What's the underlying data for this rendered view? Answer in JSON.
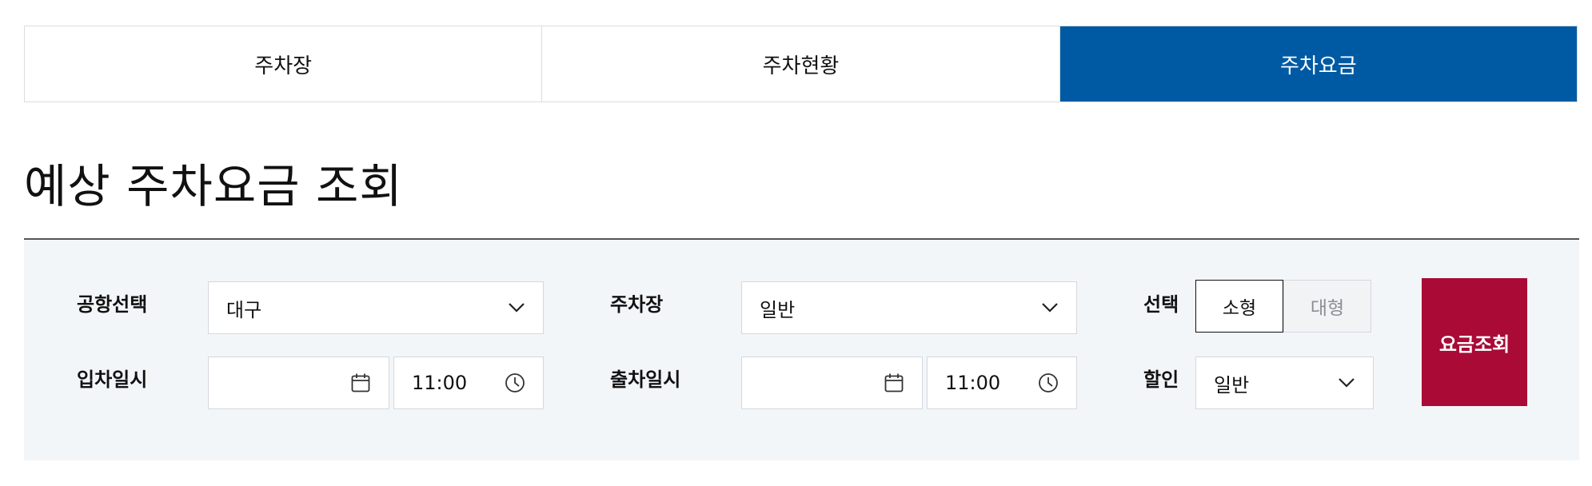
{
  "tabs": [
    {
      "label": "주차장",
      "active": false
    },
    {
      "label": "주차현황",
      "active": false
    },
    {
      "label": "주차요금",
      "active": true
    }
  ],
  "page_title": "예상 주차요금 조회",
  "form": {
    "airport": {
      "label": "공항선택",
      "value": "대구"
    },
    "parking_lot": {
      "label": "주차장",
      "value": "일반"
    },
    "car_type": {
      "label": "선택",
      "options": [
        "소형",
        "대형"
      ],
      "selected": "소형"
    },
    "entry": {
      "label": "입차일시",
      "date": "",
      "time": "11:00"
    },
    "exit": {
      "label": "출차일시",
      "date": "",
      "time": "11:00"
    },
    "discount": {
      "label": "할인",
      "value": "일반"
    },
    "submit_label": "요금조회"
  },
  "colors": {
    "active_tab": "#005aa3",
    "submit_button": "#a90a36",
    "panel_background": "#f3f6f9"
  },
  "icons": {
    "dropdown": "chevron-down-icon",
    "date": "calendar-icon",
    "time": "clock-icon"
  }
}
